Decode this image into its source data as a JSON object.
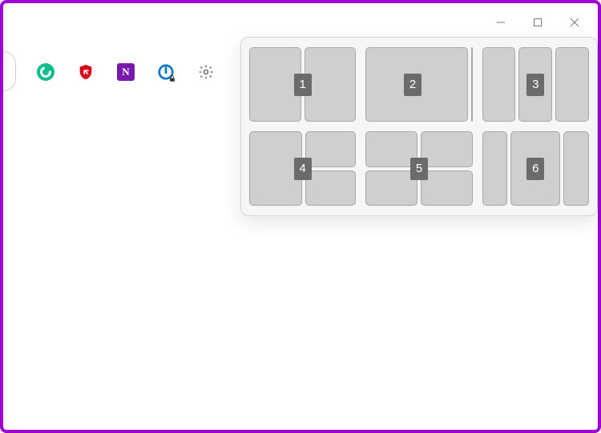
{
  "window_controls": {
    "minimize": "minimize",
    "maximize": "maximize",
    "close": "close"
  },
  "toolbar": {
    "extensions": [
      {
        "name": "grammarly-icon"
      },
      {
        "name": "ublock-icon"
      },
      {
        "name": "onenote-icon",
        "glyph": "N"
      },
      {
        "name": "idm-icon"
      },
      {
        "name": "settings-icon"
      }
    ]
  },
  "snap_layouts": {
    "options": [
      {
        "id": "1",
        "label": "1"
      },
      {
        "id": "2",
        "label": "2"
      },
      {
        "id": "3",
        "label": "3"
      },
      {
        "id": "4",
        "label": "4"
      },
      {
        "id": "5",
        "label": "5"
      },
      {
        "id": "6",
        "label": "6"
      }
    ]
  }
}
